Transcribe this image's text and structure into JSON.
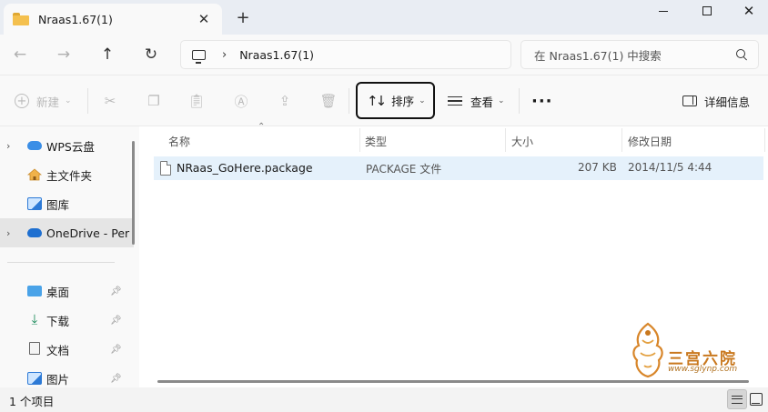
{
  "window": {
    "tab_title": "Nraas1.67(1)",
    "new_tab": "+"
  },
  "address": {
    "breadcrumb": "Nraas1.67(1)",
    "search_placeholder": "在 Nraas1.67(1) 中搜索"
  },
  "toolbar": {
    "new_label": "新建",
    "sort_label": "排序",
    "view_label": "查看",
    "more_label": "···",
    "details_label": "详细信息"
  },
  "sidebar": {
    "items": [
      {
        "label": "WPS云盘",
        "icon": "cloud-icon",
        "expandable": true
      },
      {
        "label": "主文件夹",
        "icon": "home-icon",
        "expandable": false
      },
      {
        "label": "图库",
        "icon": "gallery-icon",
        "expandable": false
      },
      {
        "label": "OneDrive - Per",
        "icon": "onedrive-icon",
        "expandable": true,
        "selected": true
      }
    ],
    "quick_access": [
      {
        "label": "桌面",
        "icon": "desktop-icon",
        "pinned": true
      },
      {
        "label": "下载",
        "icon": "download-icon",
        "pinned": true
      },
      {
        "label": "文档",
        "icon": "documents-icon",
        "pinned": true
      },
      {
        "label": "图片",
        "icon": "pictures-icon",
        "pinned": true
      }
    ]
  },
  "columns": {
    "name": "名称",
    "type": "类型",
    "size": "大小",
    "modified": "修改日期"
  },
  "files": [
    {
      "name": "NRaas_GoHere.package",
      "type": "PACKAGE 文件",
      "size": "207 KB",
      "modified": "2014/11/5 4:44"
    }
  ],
  "status": {
    "item_count": "1 个项目"
  },
  "watermark": {
    "text": "三宫六院",
    "url": "www.sglynp.com"
  },
  "colors": {
    "selected_row": "#e5f1fb",
    "sort_button_border": "#111111",
    "watermark": "#c9781e"
  }
}
